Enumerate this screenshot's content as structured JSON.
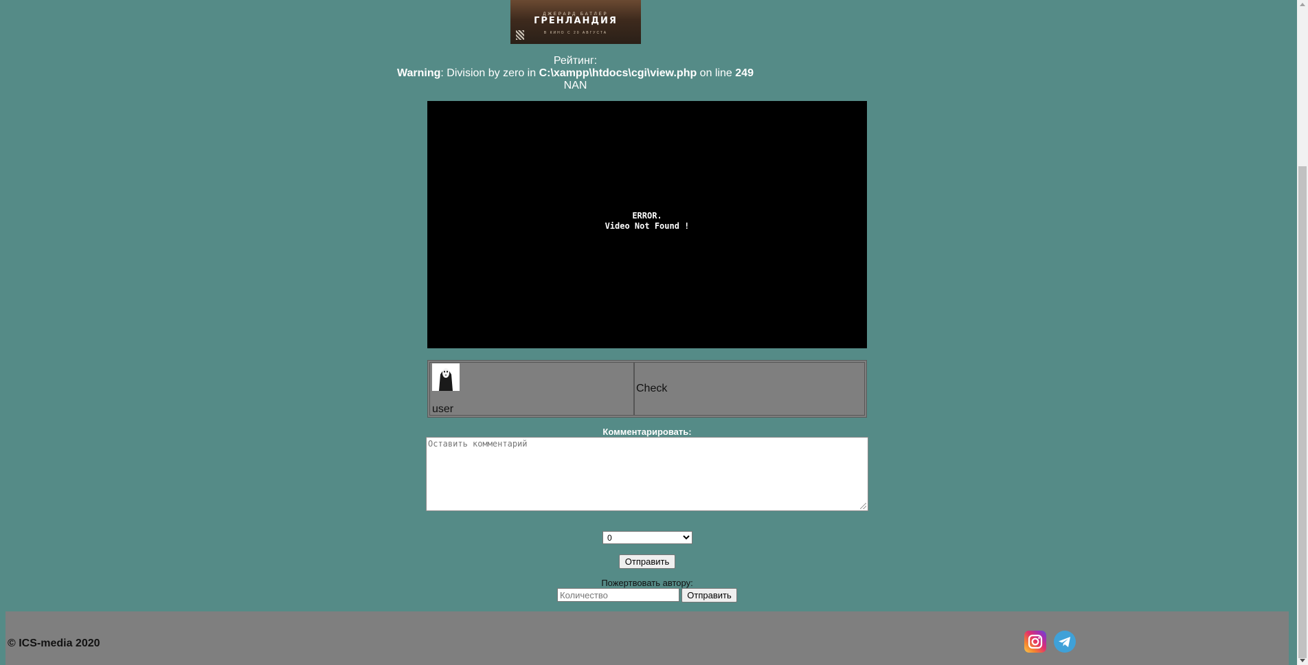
{
  "poster": {
    "subtitle": "ДЖЕРАРД БАТЛЕР",
    "title": "ГРЕНЛАНДИЯ",
    "date": "В КИНО С 20 АВГУСТА"
  },
  "rating": {
    "label": "Рейтинг:",
    "warning_prefix": "Warning",
    "warning_message": ": Division by zero in ",
    "warning_path": "C:\\xampp\\htdocs\\cgi\\view.php",
    "warning_on_line": " on line ",
    "warning_line": "249",
    "value": "NAN"
  },
  "video": {
    "error_line1": "ERROR.",
    "error_line2": "Video Not Found !"
  },
  "comments": [
    {
      "user": "user",
      "text": "Check"
    }
  ],
  "comment_form": {
    "label": "Комментарировать:",
    "placeholder": "Оставить комментарий",
    "rating_selected": "0",
    "submit_label": "Отправить"
  },
  "donate": {
    "label": "Пожертвовать автору:",
    "placeholder": "Количество",
    "submit_label": "Отправить"
  },
  "footer": {
    "copyright": "© ICS-media 2020",
    "social": [
      "instagram-icon",
      "telegram-icon"
    ]
  },
  "colors": {
    "page_background": "#558b87",
    "footer_background": "#7f7f7f",
    "comment_table_background": "#7f7f7f",
    "video_background": "#000000"
  }
}
